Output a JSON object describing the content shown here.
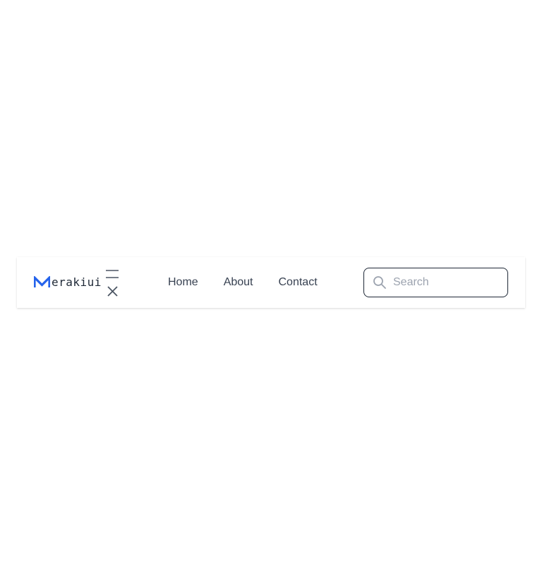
{
  "brand": {
    "text": "erakiui",
    "logo_icon": "merakiui-m-logo",
    "accent_color": "#2563eb"
  },
  "toggle": {
    "menu_icon": "menu-icon",
    "close_icon": "close-icon"
  },
  "nav": {
    "links": [
      {
        "label": "Home"
      },
      {
        "label": "About"
      },
      {
        "label": "Contact"
      }
    ]
  },
  "search": {
    "placeholder": "Search",
    "value": "",
    "icon": "search-icon"
  }
}
